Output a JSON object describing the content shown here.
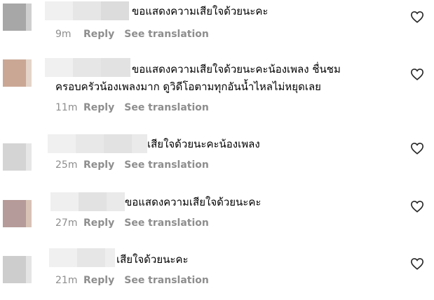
{
  "comments": [
    {
      "text": "ขอแสดงความเสียใจด้วยนะคะ",
      "text2": "",
      "time": "9m",
      "reply": "Reply",
      "translate": "See translation"
    },
    {
      "text": "ขอแสดงความเสียใจด้วยนะคะน้องเพลง ชื่นชม",
      "text2": "ครอบครัวน้องเพลงมาก ดูวิดีโอตามทุกอันน้ำไหลไม่หยุดเลย",
      "time": "11m",
      "reply": "Reply",
      "translate": "See translation"
    },
    {
      "text": "เสียใจด้วยนะคะน้องเพลง",
      "text2": "",
      "time": "25m",
      "reply": "Reply",
      "translate": "See translation"
    },
    {
      "text": "ขอแสดงความเสียใจด้วยนะคะ",
      "text2": "",
      "time": "27m",
      "reply": "Reply",
      "translate": "See translation"
    },
    {
      "text": "เสียใจด้วยนะคะ",
      "text2": "",
      "time": "21m",
      "reply": "Reply",
      "translate": "See translation"
    }
  ],
  "icons": {
    "like": "heart-outline-icon"
  },
  "colors": {
    "meta": "#8e8e8e",
    "text": "#000000",
    "blur": "#eeeeee"
  }
}
